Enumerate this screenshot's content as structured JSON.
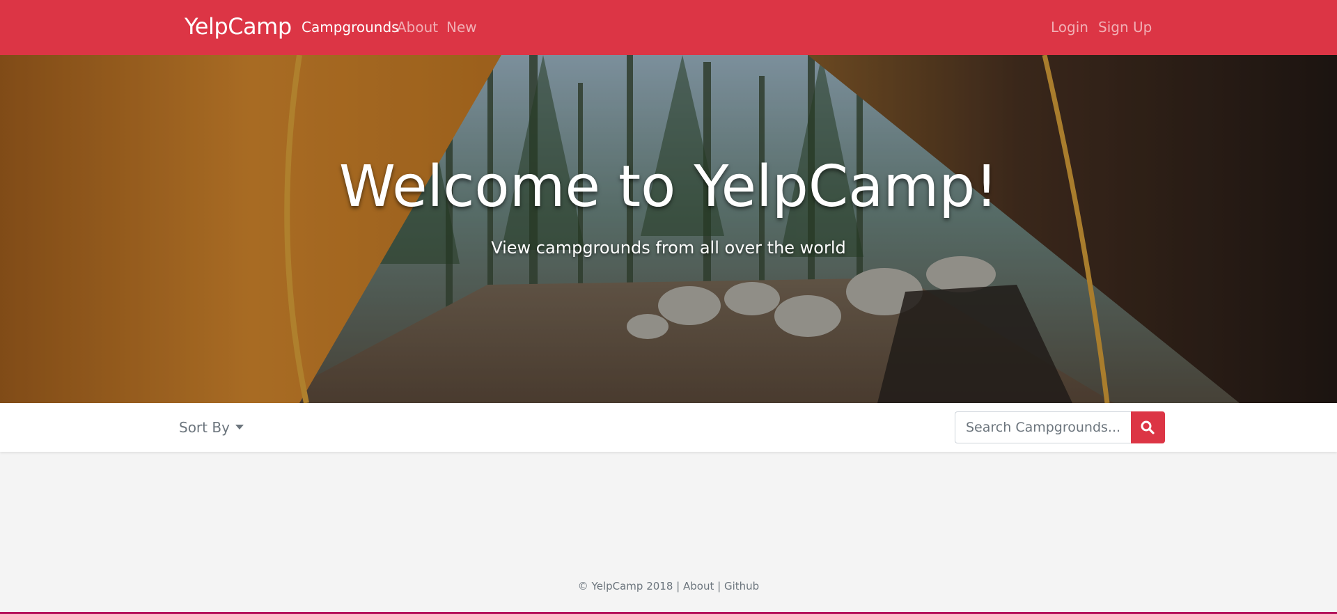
{
  "navbar": {
    "brand": "YelpCamp",
    "links": {
      "campgrounds": "Campgrounds",
      "about": "About",
      "new": "New",
      "login": "Login",
      "signup": "Sign Up"
    },
    "background_color": "#dc3545"
  },
  "hero": {
    "title": "Welcome to YelpCamp!",
    "subtitle": "View campgrounds from all over the world"
  },
  "toolbar": {
    "sort_label": "Sort By",
    "search_placeholder": "Search Campgrounds...",
    "search_value": "",
    "search_icon": "search-icon",
    "accent_color": "#dc3545"
  },
  "footer": {
    "copyright": "© YelpCamp 2018",
    "separator": "|",
    "about": "About",
    "github": "Github"
  }
}
